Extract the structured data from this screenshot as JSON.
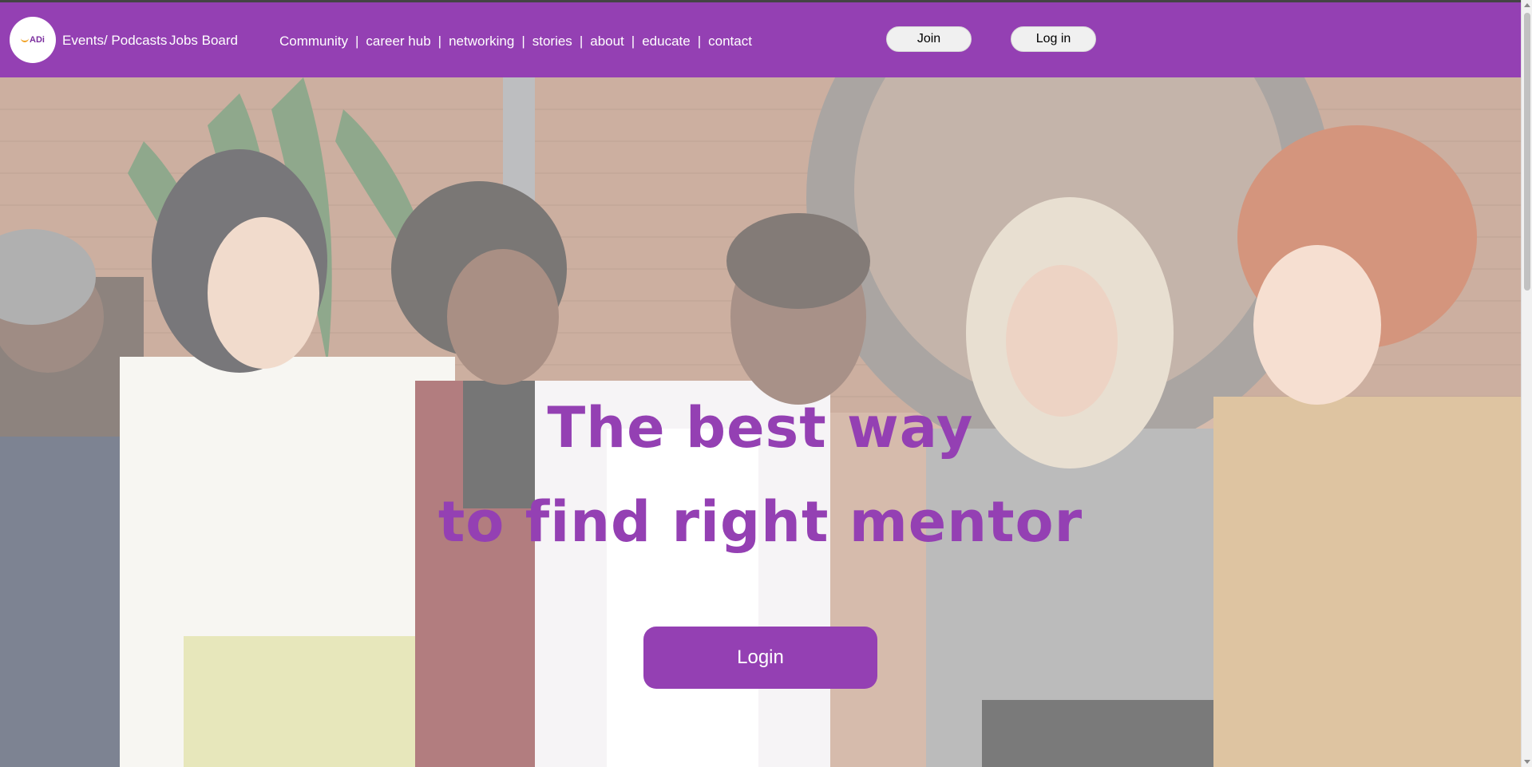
{
  "brand": {
    "logo_text": "ADi"
  },
  "header": {
    "events_label": "Events/ Podcasts",
    "jobs_label": "Jobs Board",
    "nav": [
      "Community",
      "career hub",
      "networking",
      "stories",
      "about",
      "educate",
      "contact"
    ],
    "nav_separator": "|",
    "join_label": "Join",
    "login_label": "Log in"
  },
  "hero": {
    "title_line1": "The best way",
    "title_line2": "to find right mentor",
    "cta_label": "Login"
  },
  "colors": {
    "brand_purple": "#9440b3",
    "button_light": "#f0f0f0",
    "white": "#ffffff"
  },
  "icons": {
    "scroll_up": "triangle-up",
    "scroll_down": "triangle-down"
  }
}
